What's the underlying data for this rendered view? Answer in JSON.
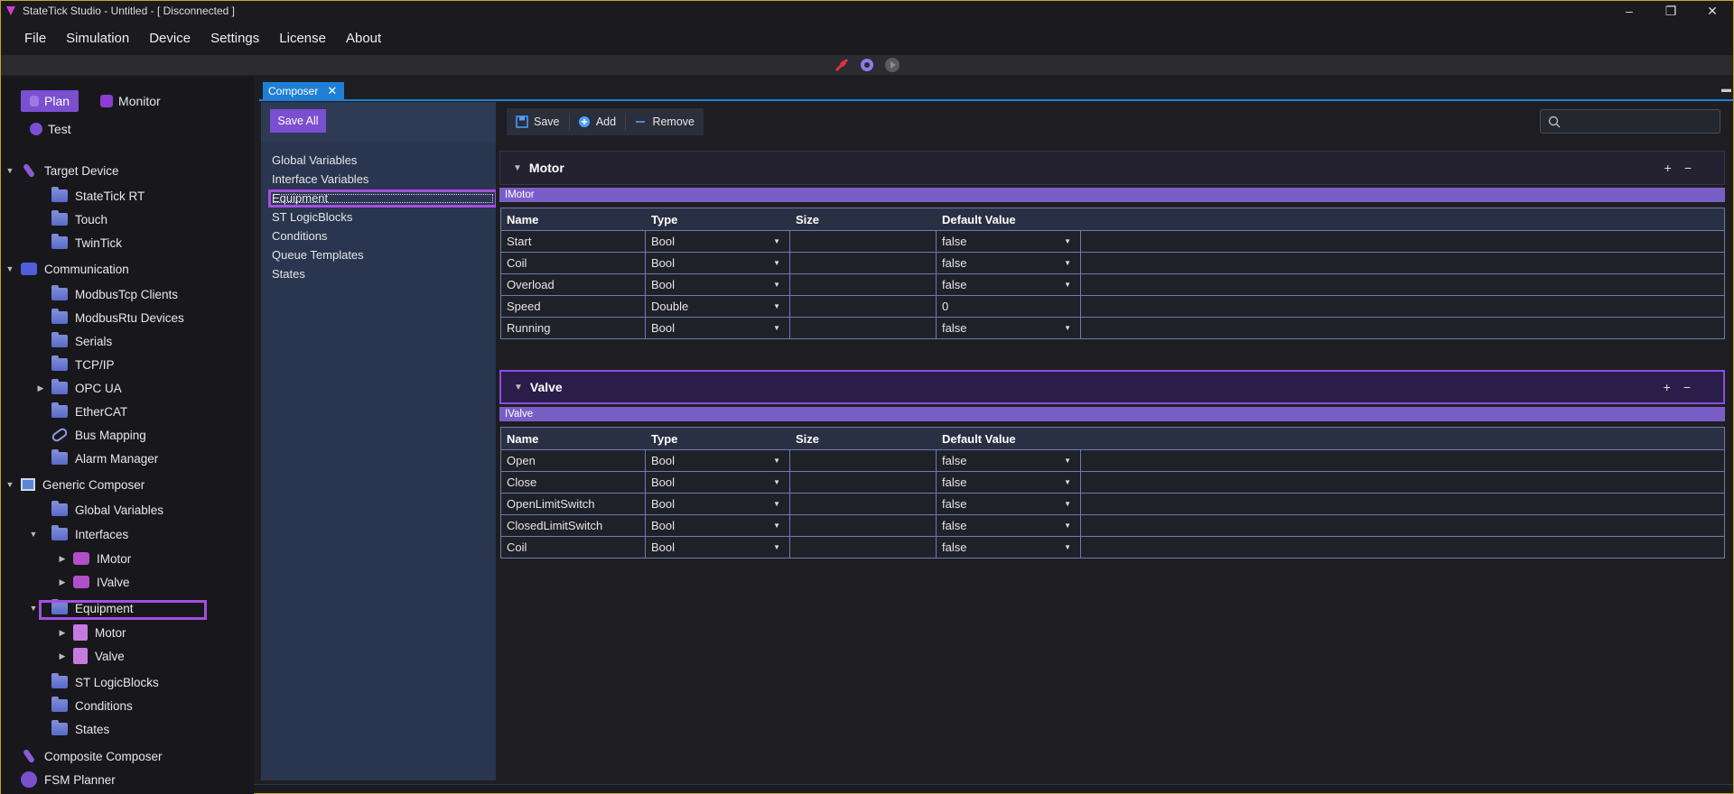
{
  "window": {
    "title": "StateTick Studio  -  Untitled  -  [ Disconnected ]",
    "controls": [
      "–",
      "❐",
      "✕"
    ]
  },
  "menu": [
    "File",
    "Simulation",
    "Device",
    "Settings",
    "License",
    "About"
  ],
  "toolbar_icons": [
    "plug-icon",
    "gear-icon",
    "play-icon"
  ],
  "modes": {
    "plan": "Plan",
    "monitor": "Monitor",
    "test": "Test"
  },
  "tree": {
    "target_device": "Target Device",
    "statetick_rt": "StateTick RT",
    "touch": "Touch",
    "twintick": "TwinTick",
    "communication": "Communication",
    "modbustcp": "ModbusTcp Clients",
    "modbusrtu": "ModbusRtu Devices",
    "serials": "Serials",
    "tcpip": "TCP/IP",
    "opcua": "OPC UA",
    "ethercat": "EtherCAT",
    "bus_mapping": "Bus Mapping",
    "alarm_manager": "Alarm Manager",
    "generic_composer": "Generic Composer",
    "global_variables": "Global Variables",
    "interfaces": "Interfaces",
    "imotor": "IMotor",
    "ivalve": "IValve",
    "equipment": "Equipment",
    "motor": "Motor",
    "valve": "Valve",
    "st_logicblocks": "ST LogicBlocks",
    "conditions": "Conditions",
    "states": "States",
    "composite_composer": "Composite Composer",
    "fsm_planner": "FSM Planner"
  },
  "composer": {
    "tab_label": "Composer",
    "tab_close": "✕",
    "save_all": "Save All",
    "categories": [
      "Global Variables",
      "Interface Variables",
      "Equipment",
      "ST LogicBlocks",
      "Conditions",
      "Queue Templates",
      "States"
    ],
    "actions": {
      "save": "Save",
      "add": "Add",
      "remove": "Remove"
    },
    "search_placeholder": "",
    "columns": [
      "Name",
      "Type",
      "Size",
      "Default Value"
    ],
    "equipment": [
      {
        "name": "Motor",
        "interface": "IMotor",
        "rows": [
          {
            "name": "Start",
            "type": "Bool",
            "size": "",
            "default": "false"
          },
          {
            "name": "Coil",
            "type": "Bool",
            "size": "",
            "default": "false"
          },
          {
            "name": "Overload",
            "type": "Bool",
            "size": "",
            "default": "false"
          },
          {
            "name": "Speed",
            "type": "Double",
            "size": "",
            "default": "0"
          },
          {
            "name": "Running",
            "type": "Bool",
            "size": "",
            "default": "false"
          }
        ]
      },
      {
        "name": "Valve",
        "interface": "IValve",
        "rows": [
          {
            "name": "Open",
            "type": "Bool",
            "size": "",
            "default": "false"
          },
          {
            "name": "Close",
            "type": "Bool",
            "size": "",
            "default": "false"
          },
          {
            "name": "OpenLimitSwitch",
            "type": "Bool",
            "size": "",
            "default": "false"
          },
          {
            "name": "ClosedLimitSwitch",
            "type": "Bool",
            "size": "",
            "default": "false"
          },
          {
            "name": "Coil",
            "type": "Bool",
            "size": "",
            "default": "false"
          }
        ]
      }
    ]
  },
  "colors": {
    "accent": "#7a4fd0",
    "highlight": "#a24fe0",
    "tab_blue": "#1f7fd6"
  }
}
